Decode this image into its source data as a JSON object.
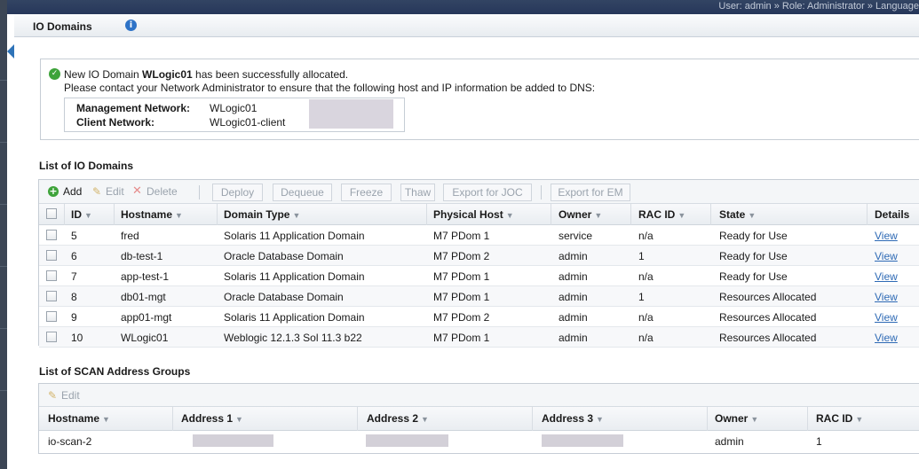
{
  "topbar": {
    "user_info": "User: admin » Role: Administrator » Language"
  },
  "page": {
    "title": "IO Domains",
    "info_icon": "info-icon"
  },
  "notification": {
    "line1_prefix": "New IO Domain ",
    "domain_name": "WLogic01",
    "line1_suffix": " has been successfully allocated.",
    "line2": "Please contact your Network Administrator to ensure that the following host and IP information be added to DNS:",
    "management_label": "Management Network:",
    "management_value": "WLogic01",
    "client_label": "Client Network:",
    "client_value": "WLogic01-client"
  },
  "io_section": {
    "heading": "List of IO Domains",
    "toolbar": {
      "add": "Add",
      "edit": "Edit",
      "delete": "Delete",
      "deploy": "Deploy",
      "dequeue": "Dequeue",
      "freeze": "Freeze",
      "thaw": "Thaw",
      "export_joc": "Export for JOC",
      "export_em": "Export for EM"
    },
    "columns": [
      "ID",
      "Hostname",
      "Domain Type",
      "Physical Host",
      "Owner",
      "RAC ID",
      "State",
      "Details"
    ],
    "rows": [
      {
        "id": "5",
        "hostname": "fred",
        "domain_type": "Solaris 11 Application Domain",
        "physical_host": "M7 PDom 1",
        "owner": "service",
        "rac_id": "n/a",
        "state": "Ready for Use",
        "details": "View"
      },
      {
        "id": "6",
        "hostname": "db-test-1",
        "domain_type": "Oracle Database Domain",
        "physical_host": "M7 PDom 2",
        "owner": "admin",
        "rac_id": "1",
        "state": "Ready for Use",
        "details": "View"
      },
      {
        "id": "7",
        "hostname": "app-test-1",
        "domain_type": "Solaris 11 Application Domain",
        "physical_host": "M7 PDom 1",
        "owner": "admin",
        "rac_id": "n/a",
        "state": "Ready for Use",
        "details": "View"
      },
      {
        "id": "8",
        "hostname": "db01-mgt",
        "domain_type": "Oracle Database Domain",
        "physical_host": "M7 PDom 1",
        "owner": "admin",
        "rac_id": "1",
        "state": "Resources Allocated",
        "details": "View"
      },
      {
        "id": "9",
        "hostname": "app01-mgt",
        "domain_type": "Solaris 11 Application Domain",
        "physical_host": "M7 PDom 2",
        "owner": "admin",
        "rac_id": "n/a",
        "state": "Resources Allocated",
        "details": "View"
      },
      {
        "id": "10",
        "hostname": "WLogic01",
        "domain_type": "Weblogic 12.1.3 Sol 11.3 b22",
        "physical_host": "M7 PDom 1",
        "owner": "admin",
        "rac_id": "n/a",
        "state": "Resources Allocated",
        "details": "View"
      }
    ]
  },
  "scan_section": {
    "heading": "List of SCAN Address Groups",
    "toolbar": {
      "edit": "Edit"
    },
    "columns": [
      "Hostname",
      "Address 1",
      "Address 2",
      "Address 3",
      "Owner",
      "RAC ID"
    ],
    "rows": [
      {
        "hostname": "io-scan-2",
        "owner": "admin",
        "rac_id": "1"
      }
    ]
  },
  "colors": {
    "accent": "#2e73c7",
    "success": "#3ea33a",
    "link": "#2e6ab5"
  }
}
